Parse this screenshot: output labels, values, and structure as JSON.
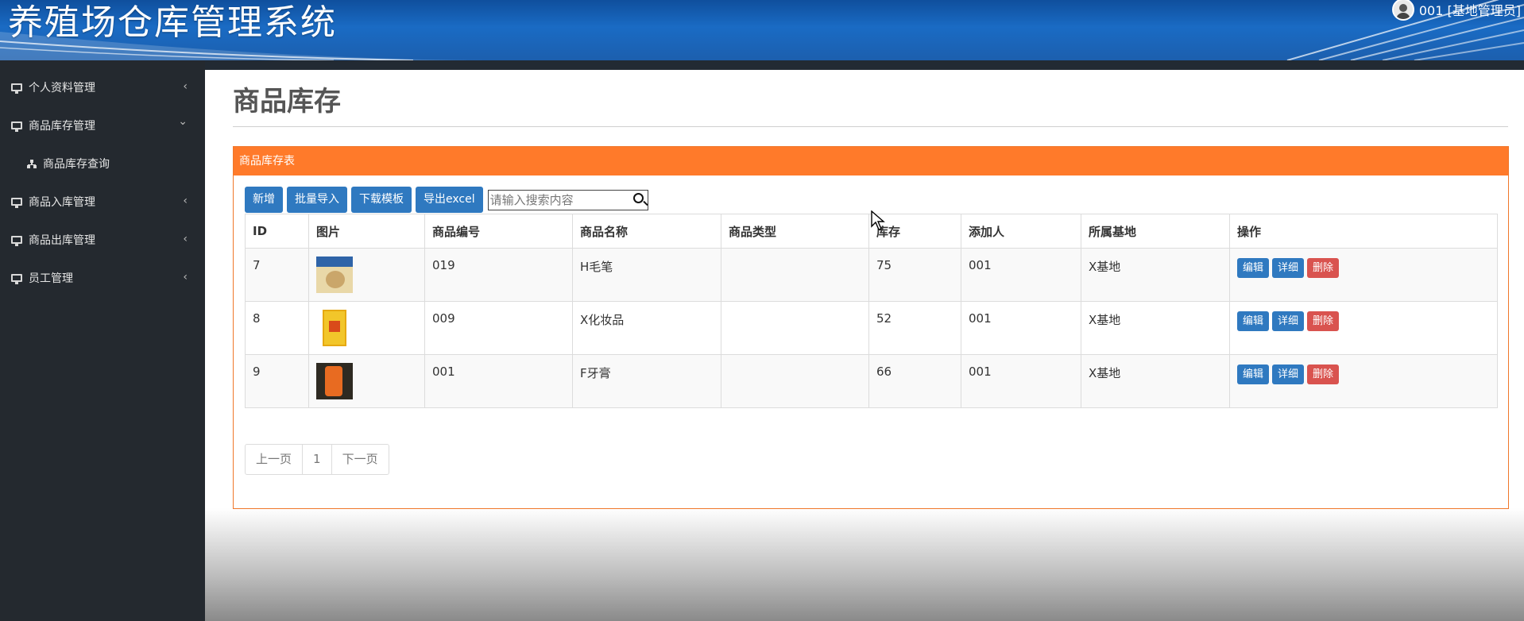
{
  "header": {
    "title": "养殖场仓库管理系统",
    "user_label": "001 [基地管理员]"
  },
  "sidebar": {
    "items": [
      {
        "label": "个人资料管理",
        "icon": "monitor-icon",
        "chevron": "‹"
      },
      {
        "label": "商品库存管理",
        "icon": "monitor-icon",
        "chevron": "⌄"
      },
      {
        "label": "商品库存查询",
        "icon": "sitemap-icon"
      },
      {
        "label": "商品入库管理",
        "icon": "monitor-icon",
        "chevron": "‹"
      },
      {
        "label": "商品出库管理",
        "icon": "monitor-icon",
        "chevron": "‹"
      },
      {
        "label": "员工管理",
        "icon": "monitor-icon",
        "chevron": "‹"
      }
    ]
  },
  "page": {
    "title": "商品库存",
    "panel_title": "商品库存表"
  },
  "toolbar": {
    "add": "新增",
    "batch_import": "批量导入",
    "download_template": "下载模板",
    "export_excel": "导出excel",
    "search_placeholder": "请输入搜索内容"
  },
  "table": {
    "headers": [
      "ID",
      "图片",
      "商品编号",
      "商品名称",
      "商品类型",
      "库存",
      "添加人",
      "所属基地",
      "操作"
    ],
    "rows": [
      {
        "id": "7",
        "code": "019",
        "name": "H毛笔",
        "type": "",
        "stock": "75",
        "added_by": "001",
        "base": "X基地"
      },
      {
        "id": "8",
        "code": "009",
        "name": "X化妆品",
        "type": "",
        "stock": "52",
        "added_by": "001",
        "base": "X基地"
      },
      {
        "id": "9",
        "code": "001",
        "name": "F牙膏",
        "type": "",
        "stock": "66",
        "added_by": "001",
        "base": "X基地"
      }
    ],
    "actions": {
      "edit": "编辑",
      "detail": "详细",
      "delete": "删除"
    }
  },
  "pager": {
    "prev": "上一页",
    "current": "1",
    "next": "下一页"
  },
  "colors": {
    "header_blue": "#1a6bc4",
    "sidebar_bg": "#24292f",
    "panel_orange": "#ff7a2a",
    "button_blue": "#2f79c0",
    "danger_red": "#d9534f"
  }
}
